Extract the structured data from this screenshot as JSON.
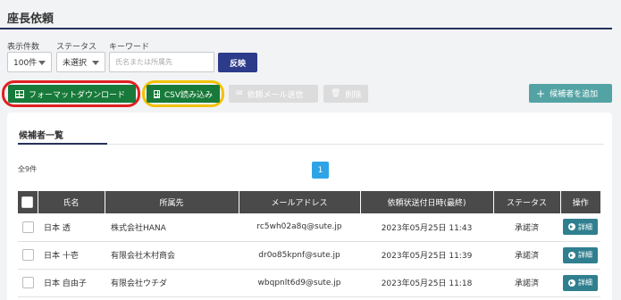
{
  "page": {
    "title": "座長依頼"
  },
  "filters": {
    "display_count_label": "表示件数",
    "status_label": "ステータス",
    "keyword_label": "キーワード",
    "display_count_value": "100件",
    "status_value": "未選択",
    "keyword_placeholder": "氏名または所属先",
    "apply_label": "反映"
  },
  "toolbar": {
    "format_download_label": "フォーマットダウンロード",
    "csv_import_label": "CSV読み込み",
    "send_request_mail_label": "依頼メール送信",
    "delete_label": "削除",
    "add_candidate_label": "候補者を追加"
  },
  "candidates": {
    "section_title": "候補者一覧",
    "total_text": "全9件",
    "current_page": "1",
    "columns": {
      "name": "氏名",
      "affiliation": "所属先",
      "email": "メールアドレス",
      "sent_at": "依頼状送付日時(最終)",
      "status": "ステータス",
      "action": "操作"
    },
    "rows": [
      {
        "name": "日本 透",
        "affiliation": "株式会社HANA",
        "email": "rc5wh02a8q@sute.jp",
        "sent_at": "2023年05月25日 11:43",
        "status": "承諾済",
        "action": "詳細"
      },
      {
        "name": "日本 十壱",
        "affiliation": "有限会社木村商会",
        "email": "dr0o85kpnf@sute.jp",
        "sent_at": "2023年05月25日 11:39",
        "status": "承諾済",
        "action": "詳細"
      },
      {
        "name": "日本 自由子",
        "affiliation": "有限会社ウチダ",
        "email": "wbqpnlt6d9@sute.jp",
        "sent_at": "2023年05月25日 11:18",
        "status": "承諾済",
        "action": "詳細"
      }
    ]
  },
  "colors": {
    "title_rule": "#27325a",
    "primary_button": "#2c3b8a",
    "green_button": "#177a3a",
    "teal_button": "#54a3a4",
    "detail_button": "#2f7f8f",
    "pager_active": "#2ea4e6",
    "table_header": "#4a4a4a",
    "highlight_red": "#e02020",
    "highlight_yellow": "#f2c200"
  }
}
